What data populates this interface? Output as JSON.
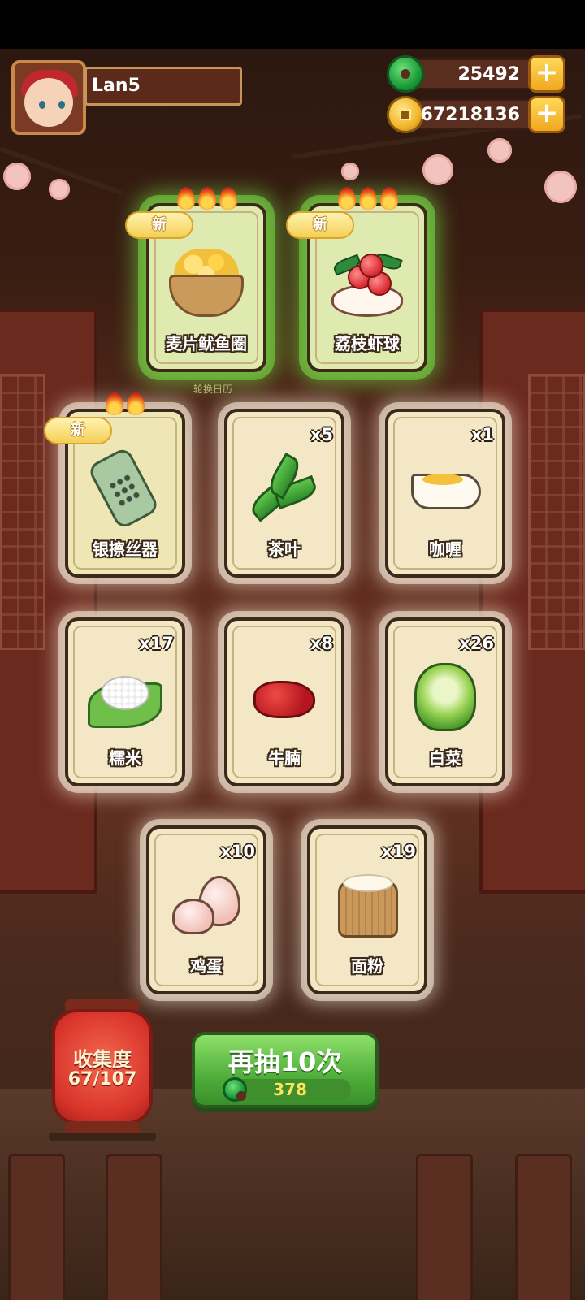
{
  "player": {
    "name": "Lan5"
  },
  "currencies": {
    "jade": {
      "value": "25492",
      "icon": "jade-icon"
    },
    "coins": {
      "value": "67218136",
      "icon": "coin-icon"
    }
  },
  "plus_label": "+",
  "calendar_label": "轮换日历",
  "cards": {
    "squid_rings": {
      "name": "麦片鱿鱼圈",
      "new_label": "新",
      "flames": 3
    },
    "lychee_shrimp": {
      "name": "荔枝虾球",
      "new_label": "新",
      "flames": 3
    },
    "silver_grater": {
      "name": "银擦丝器",
      "new_label": "新",
      "flames": 2
    },
    "tea": {
      "name": "茶叶",
      "qty": "x5"
    },
    "curry": {
      "name": "咖喱",
      "qty": "x1"
    },
    "glutinous_rice": {
      "name": "糯米",
      "qty": "x17"
    },
    "beef_shank": {
      "name": "牛腩",
      "qty": "x8"
    },
    "cabbage": {
      "name": "白菜",
      "qty": "x26"
    },
    "egg": {
      "name": "鸡蛋",
      "qty": "x10"
    },
    "flour": {
      "name": "面粉",
      "qty": "x19"
    }
  },
  "collection": {
    "title": "收集度",
    "progress": "67/107"
  },
  "redraw": {
    "label": "再抽10次",
    "cost": "378"
  }
}
